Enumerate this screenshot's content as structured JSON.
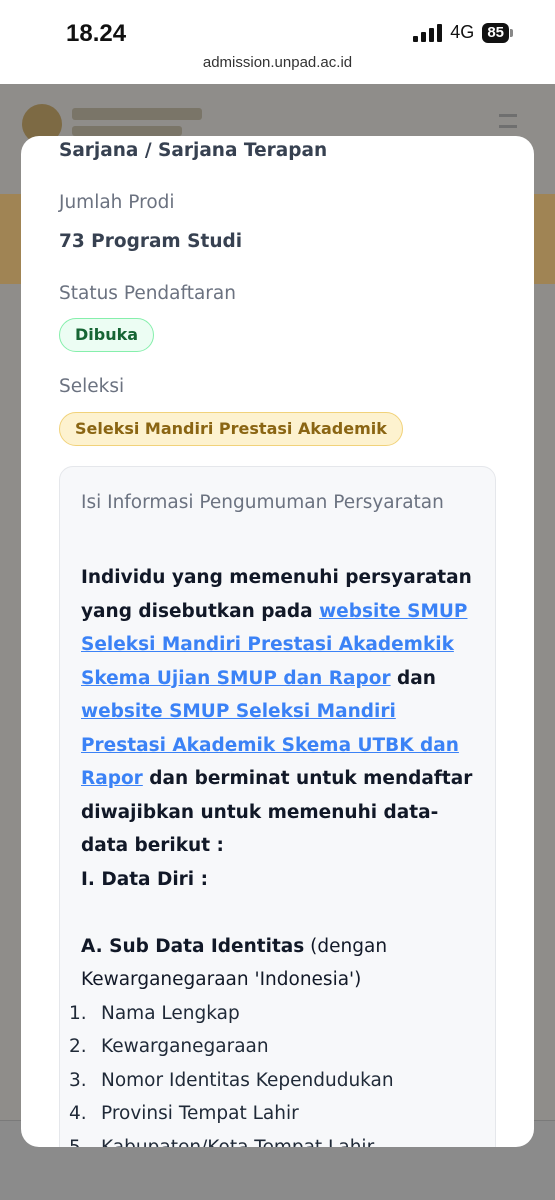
{
  "status_bar": {
    "time": "18.24",
    "network": "4G",
    "battery": "85"
  },
  "browser": {
    "url": "admission.unpad.ac.id"
  },
  "modal": {
    "level": "Sarjana / Sarjana Terapan",
    "prodi_label": "Jumlah Prodi",
    "prodi_value": "73 Program Studi",
    "status_label": "Status Pendaftaran",
    "status_badge": "Dibuka",
    "seleksi_label": "Seleksi",
    "seleksi_badge": "Seleksi Mandiri Prestasi Akademik",
    "info": {
      "title": "Isi Informasi Pengumuman Persyaratan",
      "intro_1": "Individu yang memenuhi persyaratan yang disebutkan pada ",
      "link_1": "website SMUP Seleksi Mandiri Prestasi Akademkik Skema Ujian SMUP dan Rapor",
      "intro_2": " dan ",
      "link_2": "website SMUP Seleksi Mandiri Prestasi Akademik Skema UTBK dan Rapor",
      "intro_3": " dan berminat untuk mendaftar diwajibkan untuk memenuhi data-data berikut :",
      "section_1": "I. Data Diri :",
      "sub_a_bold": "A. Sub Data Identitas",
      "sub_a_rest": " (dengan Kewarganegaraan 'Indonesia')",
      "items": [
        {
          "num": "1.",
          "text": "Nama Lengkap"
        },
        {
          "num": "2.",
          "text": "Kewarganegaraan"
        },
        {
          "num": "3.",
          "text": "Nomor Identitas Kependudukan"
        },
        {
          "num": "4.",
          "text": "Provinsi Tempat Lahir"
        },
        {
          "num": "5.",
          "text": "Kabupaten/Kota Tempat Lahir"
        }
      ]
    }
  }
}
